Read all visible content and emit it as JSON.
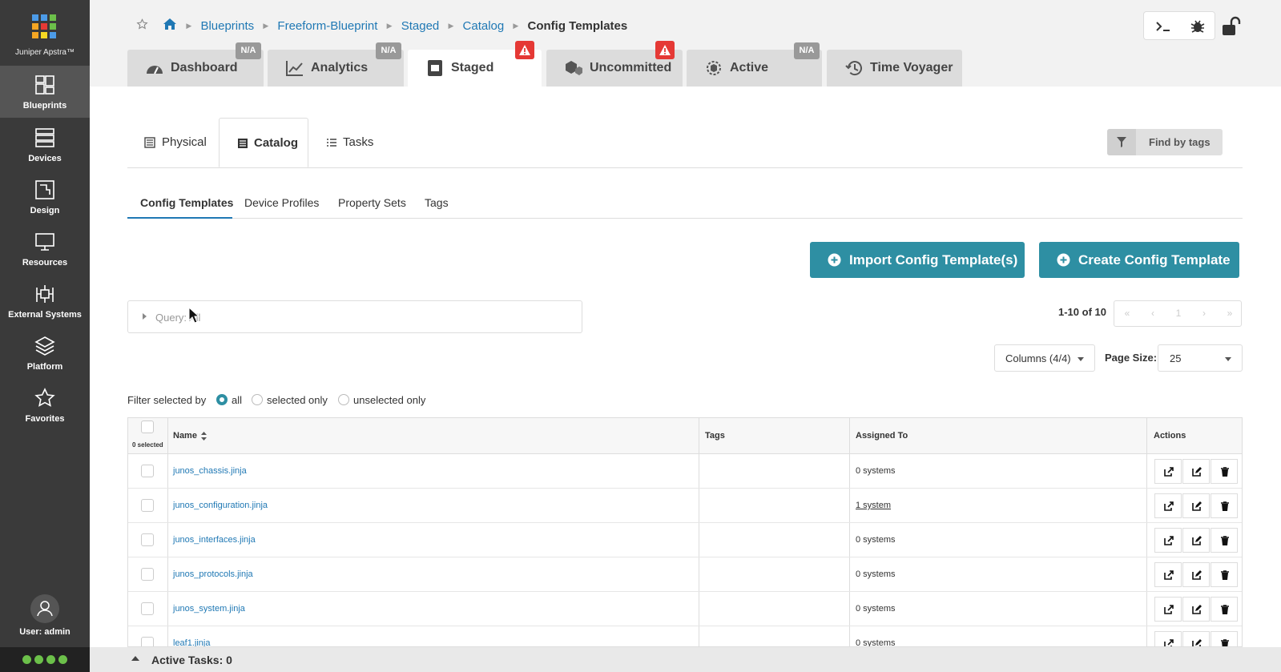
{
  "app": {
    "name": "Juniper Apstra™"
  },
  "sidebar": {
    "items": [
      {
        "label": "Blueprints",
        "icon": "blueprints-icon"
      },
      {
        "label": "Devices",
        "icon": "devices-icon"
      },
      {
        "label": "Design",
        "icon": "design-icon"
      },
      {
        "label": "Resources",
        "icon": "resources-icon"
      },
      {
        "label": "External Systems",
        "icon": "external-systems-icon"
      },
      {
        "label": "Platform",
        "icon": "platform-icon"
      },
      {
        "label": "Favorites",
        "icon": "star-icon"
      }
    ],
    "user": "User: admin"
  },
  "breadcrumb": [
    "Blueprints",
    "Freeform-Blueprint",
    "Staged",
    "Catalog",
    "Config Templates"
  ],
  "top_tabs": [
    {
      "label": "Dashboard",
      "badge": "N/A"
    },
    {
      "label": "Analytics",
      "badge": "N/A"
    },
    {
      "label": "Staged",
      "badge": "warning"
    },
    {
      "label": "Uncommitted",
      "badge": "warning"
    },
    {
      "label": "Active",
      "badge": "N/A"
    },
    {
      "label": "Time Voyager"
    }
  ],
  "sub_tabs": [
    "Physical",
    "Catalog",
    "Tasks"
  ],
  "find_by_tags": "Find by tags",
  "catalog_tabs": [
    "Config Templates",
    "Device Profiles",
    "Property Sets",
    "Tags"
  ],
  "buttons": {
    "import": "Import Config Template(s)",
    "create": "Create Config Template"
  },
  "query": "Query: All",
  "pagination": {
    "info": "1-10 of 10",
    "first": "«",
    "prev": "‹",
    "page": "1",
    "next": "›",
    "last": "»"
  },
  "columns": "Columns (4/4)",
  "page_size": {
    "label": "Page Size:",
    "value": "25"
  },
  "filter": {
    "label": "Filter selected by",
    "options": [
      "all",
      "selected only",
      "unselected only"
    ],
    "selected": "all"
  },
  "table": {
    "selected_count": "0 selected",
    "headers": [
      "Name",
      "Tags",
      "Assigned To",
      "Actions"
    ],
    "rows": [
      {
        "name": "junos_chassis.jinja",
        "tags": "",
        "assigned": "0 systems"
      },
      {
        "name": "junos_configuration.jinja",
        "tags": "",
        "assigned": "1 system"
      },
      {
        "name": "junos_interfaces.jinja",
        "tags": "",
        "assigned": "0 systems"
      },
      {
        "name": "junos_protocols.jinja",
        "tags": "",
        "assigned": "0 systems"
      },
      {
        "name": "junos_system.jinja",
        "tags": "",
        "assigned": "0 systems"
      },
      {
        "name": "leaf1.jinja",
        "tags": "",
        "assigned": "0 systems"
      }
    ]
  },
  "bottom": "Active Tasks: 0",
  "colors": {
    "accent": "#2e8fa3",
    "link": "#1f78b4",
    "sidebar": "#3a3a3a",
    "warning": "#e53935",
    "status": "#6cc04a"
  }
}
